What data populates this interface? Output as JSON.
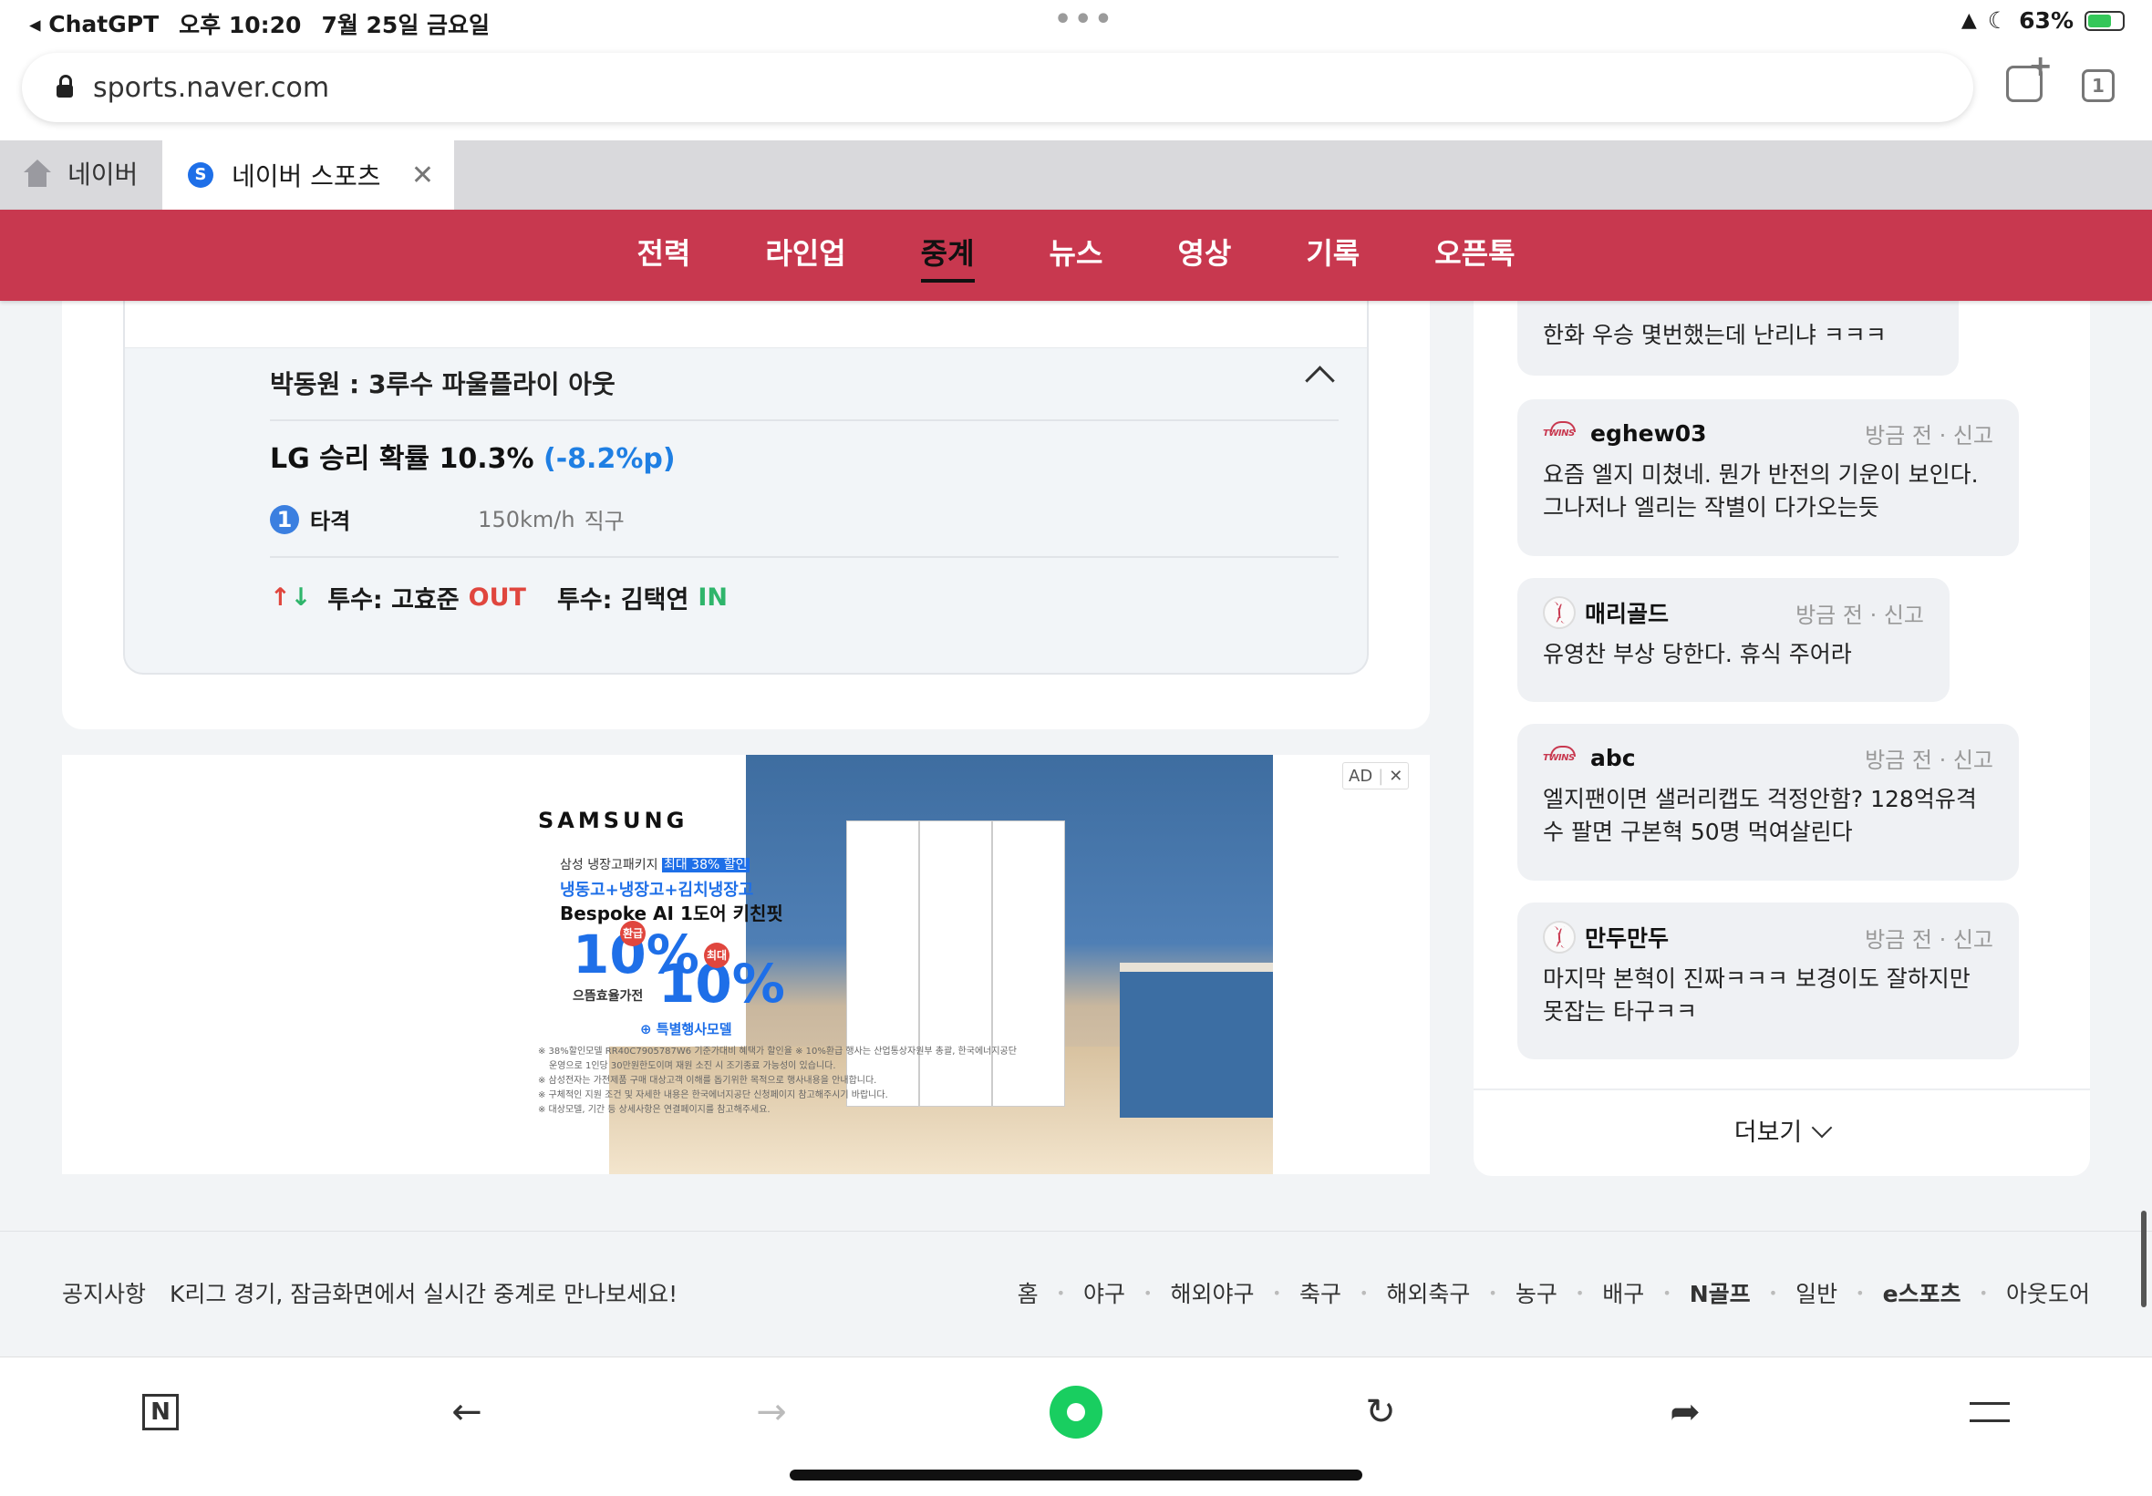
{
  "status_bar": {
    "back_app": "ChatGPT",
    "time": "오후 10:20",
    "date": "7월 25일 금요일",
    "battery": "63%"
  },
  "browser": {
    "url": "sports.naver.com",
    "tab_count": "1",
    "tabs": [
      {
        "label": "네이버",
        "icon": "home-icon"
      },
      {
        "label": "네이버 스포츠",
        "icon": "naver-sports-icon",
        "active": true
      }
    ]
  },
  "nav": {
    "items": [
      "전력",
      "라인업",
      "중계",
      "뉴스",
      "영상",
      "기록",
      "오픈톡"
    ],
    "active": "중계",
    "color": "#c8384f"
  },
  "play": {
    "description": "박동원 : 3루수 파울플라이 아웃",
    "win_prob_label": "LG 승리 확률 10.3%",
    "win_prob_delta": "(-8.2%p)",
    "pitch_number": "1",
    "pitch_result": "타격",
    "pitch_speed": "150km/h",
    "pitch_type": "직구",
    "change_out_label": "투수: 고효준",
    "change_out_tag": "OUT",
    "change_in_label": "투수: 김택연",
    "change_in_tag": "IN"
  },
  "ad": {
    "badge": "AD",
    "brand": "SAMSUNG",
    "line1_prefix": "삼성 냉장고패키지",
    "line1_highlight": "최대 38% 할인",
    "line2": "냉동고+냉장고+김치냉장고",
    "line3": "Bespoke AI 1도어 키친핏",
    "big_a": "10%",
    "badge_a": "환급",
    "efficiency": "으뜸효율가전",
    "big_b": "10%",
    "badge_b": "최대",
    "model": "특별행사모델",
    "fine_print": [
      "※ 38%할인모델 RR40C7905787W6 기준가대비 혜택가 할인율 ※ 10%환급 행사는 산업통상자원부 총괄, 한국에너지공단",
      "운영으로 1인당 30만원한도이며 재원 소진 시 조기종료 가능성이 있습니다.",
      "※ 삼성전자는 가전제품 구매 대상고객 이해를 돕기위한 목적으로 행사내용을 안내합니다.",
      "※ 구체적인 지원 조건 및 자세한 내용은 한국에너지공단 신청페이지 참고해주시기 바랍니다.",
      "※ 대상모델, 기간 등 상세사항은 연결페이지를 참고해주세요."
    ]
  },
  "chat": {
    "messages": [
      {
        "user": "",
        "team": "",
        "time": "",
        "report": "",
        "text": "한화 우승 몇번했는데 난리냐 ㅋㅋㅋ"
      },
      {
        "user": "eghew03",
        "team": "twins",
        "time": "방금 전",
        "report": "신고",
        "text": "요즘 엘지 미쳤네. 뭔가 반전의 기운이 보인다. 그나저나 엘리는 작별이 다가오는듯"
      },
      {
        "user": "매리골드",
        "team": "baseball",
        "time": "방금 전",
        "report": "신고",
        "text": "유영찬 부상 당한다. 휴식 주어라"
      },
      {
        "user": "abc",
        "team": "twins",
        "time": "방금 전",
        "report": "신고",
        "text": "엘지팬이면 샐러리캡도 걱정안함? 128억유격수 팔면 구본혁 50명 먹여살린다"
      },
      {
        "user": "만두만두",
        "team": "baseball",
        "time": "방금 전",
        "report": "신고",
        "text": "마지막 본혁이 진짜ㅋㅋㅋ 보경이도 잘하지만 못잡는 타구ㅋㅋ"
      }
    ],
    "more_label": "더보기"
  },
  "footer": {
    "notice_label": "공지사항",
    "notice_text": "K리그 경기, 잠금화면에서 실시간 중계로 만나보세요!",
    "links": [
      "홈",
      "야구",
      "해외야구",
      "축구",
      "해외축구",
      "농구",
      "배구",
      "N골프",
      "일반",
      "e스포츠",
      "아웃도어"
    ]
  },
  "toolbar": {
    "icons": [
      "naver-n-icon",
      "back-arrow-icon",
      "forward-arrow-icon",
      "green-dot-icon",
      "refresh-icon",
      "share-icon",
      "menu-icon"
    ]
  }
}
